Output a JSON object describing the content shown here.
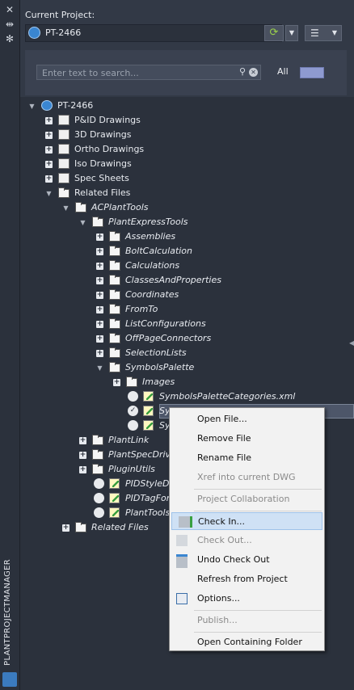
{
  "side": {
    "title": "PLANTPROJECTMANAGER",
    "icons": [
      "close-icon",
      "auto-hide-icon",
      "settings-icon"
    ]
  },
  "header": {
    "current_project_label": "Current Project:",
    "project_name": "PT-2466",
    "filter_all_label": "All"
  },
  "search": {
    "placeholder": "Enter text to search..."
  },
  "tree": [
    {
      "label": "PT-2466",
      "italic": false,
      "depth": 0,
      "expander": "minus",
      "icon": "project-icon"
    },
    {
      "label": "P&ID Drawings",
      "italic": false,
      "depth": 1,
      "expander": "plus",
      "icon": "pid-drawing-icon"
    },
    {
      "label": "3D Drawings",
      "italic": false,
      "depth": 1,
      "expander": "plus",
      "icon": "3d-drawing-icon"
    },
    {
      "label": "Ortho Drawings",
      "italic": false,
      "depth": 1,
      "expander": "plus",
      "icon": "ortho-drawing-icon"
    },
    {
      "label": "Iso Drawings",
      "italic": false,
      "depth": 1,
      "expander": "plus",
      "icon": "iso-drawing-icon"
    },
    {
      "label": "Spec Sheets",
      "italic": false,
      "depth": 1,
      "expander": "plus",
      "icon": "spec-sheet-icon"
    },
    {
      "label": "Related Files",
      "italic": false,
      "depth": 1,
      "expander": "minus",
      "icon": "folder-icon"
    },
    {
      "label": "ACPlantTools",
      "italic": true,
      "depth": 2,
      "expander": "minus",
      "icon": "folder-icon"
    },
    {
      "label": "PlantExpressTools",
      "italic": true,
      "depth": 3,
      "expander": "minus",
      "icon": "folder-icon"
    },
    {
      "label": "Assemblies",
      "italic": true,
      "depth": 4,
      "expander": "plus",
      "icon": "folder-icon"
    },
    {
      "label": "BoltCalculation",
      "italic": true,
      "depth": 4,
      "expander": "plus",
      "icon": "folder-icon"
    },
    {
      "label": "Calculations",
      "italic": true,
      "depth": 4,
      "expander": "plus",
      "icon": "folder-icon"
    },
    {
      "label": "ClassesAndProperties",
      "italic": true,
      "depth": 4,
      "expander": "plus",
      "icon": "folder-icon"
    },
    {
      "label": "Coordinates",
      "italic": true,
      "depth": 4,
      "expander": "plus",
      "icon": "folder-icon"
    },
    {
      "label": "FromTo",
      "italic": true,
      "depth": 4,
      "expander": "plus",
      "icon": "folder-icon"
    },
    {
      "label": "ListConfigurations",
      "italic": true,
      "depth": 4,
      "expander": "plus",
      "icon": "folder-icon"
    },
    {
      "label": "OffPageConnectors",
      "italic": true,
      "depth": 4,
      "expander": "plus",
      "icon": "folder-icon"
    },
    {
      "label": "SelectionLists",
      "italic": true,
      "depth": 4,
      "expander": "plus",
      "icon": "folder-icon"
    },
    {
      "label": "SymbolsPalette",
      "italic": true,
      "depth": 4,
      "expander": "minus",
      "icon": "folder-icon"
    },
    {
      "label": "Images",
      "italic": true,
      "depth": 5,
      "expander": "plus",
      "icon": "folder-icon"
    },
    {
      "label": "SymbolsPaletteCategories.xml",
      "italic": true,
      "depth": 6,
      "expander": "status-circle",
      "icon": "xml-file-icon"
    },
    {
      "label": "Sy",
      "italic": true,
      "depth": 6,
      "expander": "status-check",
      "icon": "xml-file-icon"
    },
    {
      "label": "Sy",
      "italic": true,
      "depth": 6,
      "expander": "status-circle",
      "icon": "xml-file-icon"
    },
    {
      "label": "PlantLink",
      "italic": true,
      "depth": 3,
      "expander": "plus",
      "icon": "folder-icon"
    },
    {
      "label": "PlantSpecDriver",
      "italic": true,
      "depth": 3,
      "expander": "plus",
      "icon": "folder-icon"
    },
    {
      "label": "PluginUtils",
      "italic": true,
      "depth": 3,
      "expander": "plus",
      "icon": "folder-icon"
    },
    {
      "label": "PIDStyleDe",
      "italic": true,
      "depth": 4,
      "expander": "status-circle",
      "icon": "xml-file-icon"
    },
    {
      "label": "PIDTagFor",
      "italic": true,
      "depth": 4,
      "expander": "status-circle",
      "icon": "xml-file-icon"
    },
    {
      "label": "PlantToolsS",
      "italic": true,
      "depth": 4,
      "expander": "status-circle",
      "icon": "xml-file-icon"
    },
    {
      "label": "Related Files",
      "italic": true,
      "depth": 2,
      "expander": "plus",
      "icon": "folder-icon"
    }
  ],
  "context_menu": [
    {
      "label": "Open File...",
      "disabled": false,
      "icon": ""
    },
    {
      "label": "Remove File",
      "disabled": false,
      "icon": ""
    },
    {
      "label": "Rename File",
      "disabled": false,
      "icon": ""
    },
    {
      "label": "Xref into current DWG",
      "disabled": true,
      "icon": ""
    },
    {
      "sep": true
    },
    {
      "label": "Project Collaboration",
      "disabled": true,
      "icon": ""
    },
    {
      "sep": true
    },
    {
      "label": "Check In...",
      "disabled": false,
      "icon": "check-in-icon",
      "hover": true
    },
    {
      "label": "Check Out...",
      "disabled": true,
      "icon": "check-out-icon"
    },
    {
      "label": "Undo Check Out",
      "disabled": false,
      "icon": "undo-check-out-icon"
    },
    {
      "label": "Refresh from Project",
      "disabled": false,
      "icon": ""
    },
    {
      "label": "Options...",
      "disabled": false,
      "icon": "options-icon"
    },
    {
      "sep": true
    },
    {
      "label": "Publish...",
      "disabled": true,
      "icon": ""
    },
    {
      "sep": true
    },
    {
      "label": "Open Containing Folder",
      "disabled": false,
      "icon": ""
    }
  ],
  "colors": {
    "panel_bg": "#2b313c",
    "selection": "#4d5669",
    "menu_hover": "#cfe1f5",
    "accent_green": "#9bd14a"
  }
}
